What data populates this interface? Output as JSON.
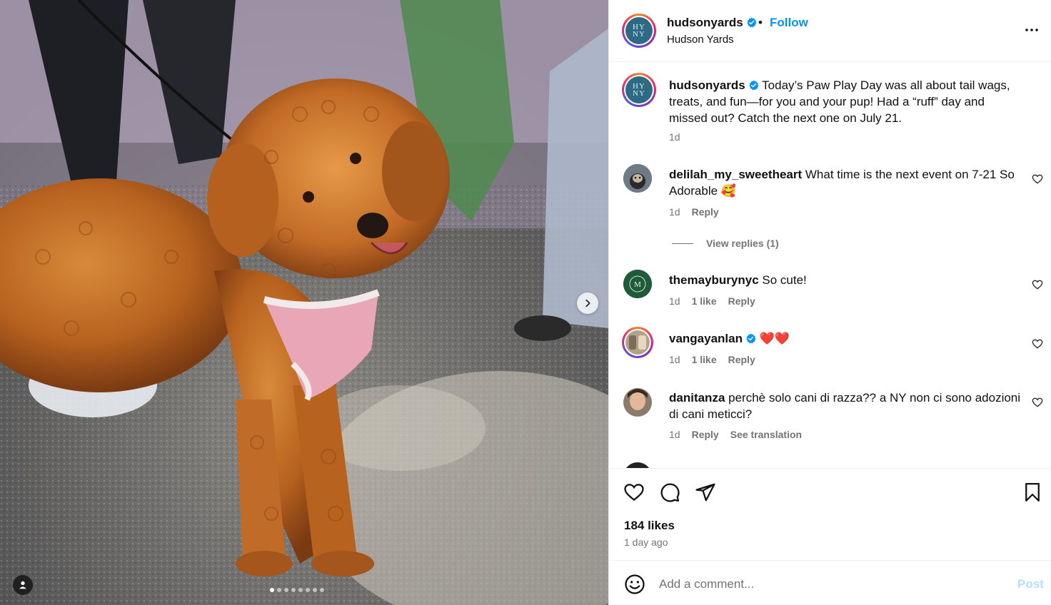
{
  "post": {
    "username": "hudsonyards",
    "separator": "•",
    "follow_label": "Follow",
    "location": "Hudson Yards",
    "avatar_text": "HY NY",
    "carousel": {
      "total": 8,
      "active": 1
    }
  },
  "caption": {
    "username": "hudsonyards",
    "text": "Today’s Paw Play Day was all about tail wags, treats, and fun—for you and your pup! Had a “ruff” day and missed out? Catch the next one on July 21.",
    "time": "1d"
  },
  "comments": [
    {
      "username": "delilah_my_sweetheart",
      "verified": false,
      "text": "What time is the next event on 7-21 So Adorable 🥰",
      "time": "1d",
      "likes": "",
      "reply": "Reply",
      "extra": ""
    },
    {
      "username": "themayburynyc",
      "verified": false,
      "text": "So cute!",
      "time": "1d",
      "likes": "1 like",
      "reply": "Reply",
      "extra": ""
    },
    {
      "username": "vangayanlan",
      "verified": true,
      "text": "❤️❤️",
      "time": "1d",
      "likes": "1 like",
      "reply": "Reply",
      "extra": ""
    },
    {
      "username": "danitanza",
      "verified": false,
      "text": "perchè solo cani di razza?? a NY non ci sono adozioni di cani meticci?",
      "time": "1d",
      "likes": "",
      "reply": "Reply",
      "extra": "See translation"
    }
  ],
  "view_replies": "View replies (1)",
  "likes_text": "184 likes",
  "time_ago": "1 day ago",
  "add_comment": {
    "placeholder": "Add a comment...",
    "post_label": "Post"
  },
  "colors": {
    "follow": "#0095f6",
    "verified": "#0095f6",
    "post_disabled": "#b2dffc",
    "secondary_text": "#737373"
  },
  "icons": [
    "more-options-icon",
    "heart-icon",
    "comment-icon",
    "share-icon",
    "bookmark-icon",
    "emoji-icon",
    "chevron-right-icon",
    "user-tag-icon",
    "verified-badge-icon"
  ]
}
